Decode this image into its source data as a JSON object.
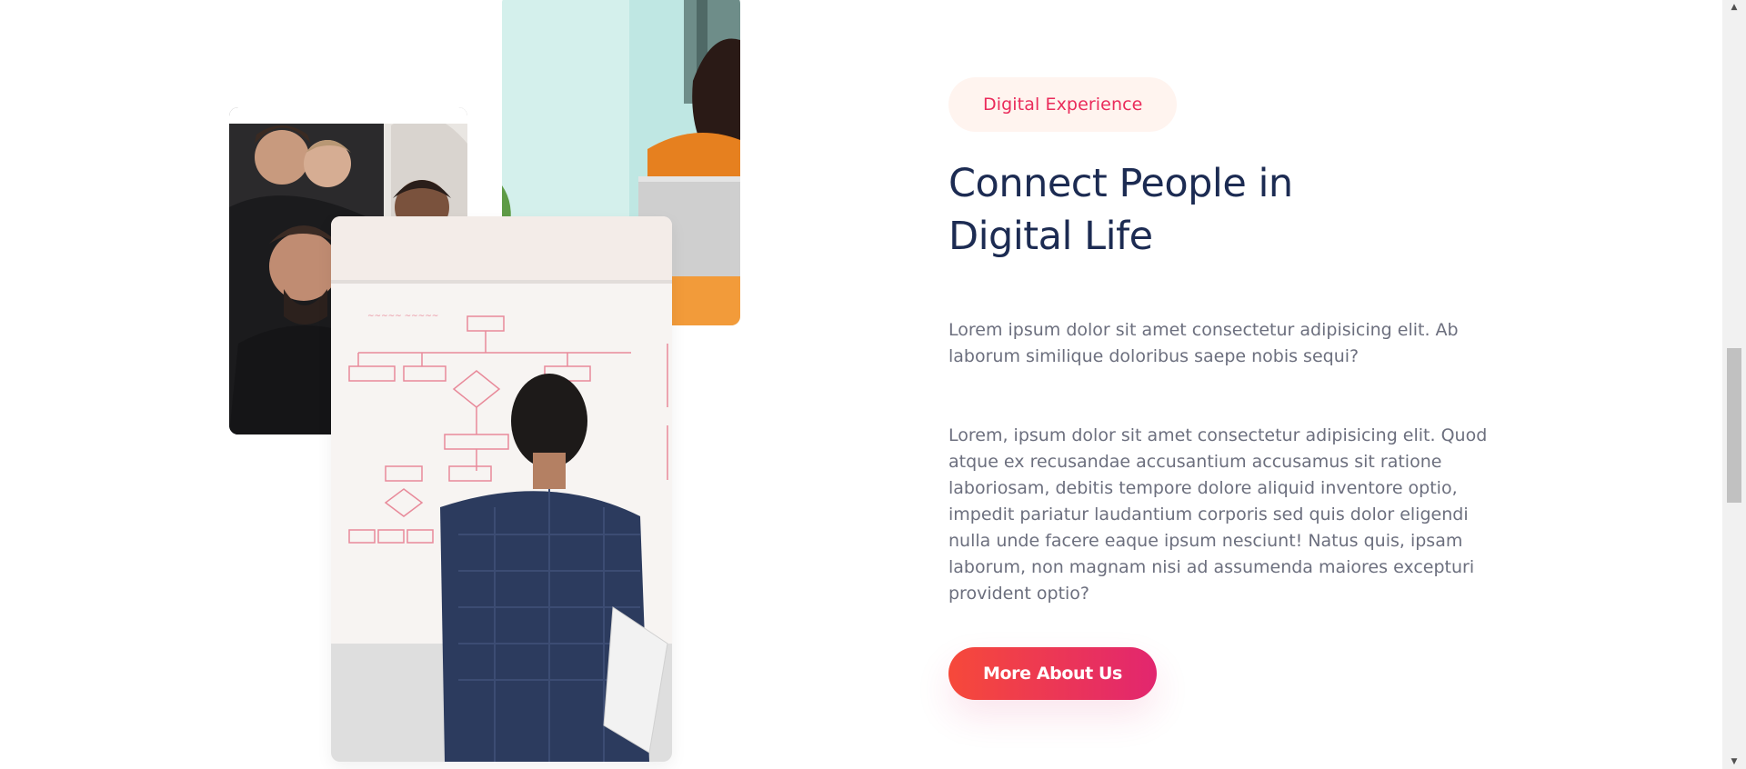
{
  "about": {
    "tag_label": "Digital Experience",
    "heading": "Connect People in Digital Life",
    "paragraph_1": "Lorem ipsum dolor sit amet consectetur adipisicing elit. Ab laborum similique doloribus saepe nobis sequi?",
    "paragraph_2": "Lorem, ipsum dolor sit amet consectetur adipisicing elit. Quod atque ex recusandae accusantium accusamus sit ratione laboriosam, debitis tempore dolore aliquid inventore optio, impedit pariatur laudantium corporis sed quis dolor eligendi nulla unde facere eaque ipsum nesciunt! Natus quis, ipsam laborum, non magnam nisi ad assumenda maiores excepturi provident optio?",
    "cta_label": "More About Us"
  },
  "images": {
    "team": "team-photo",
    "laptop": "woman-laptop-photo",
    "whiteboard": "whiteboard-photo"
  },
  "colors": {
    "accent": "#ea2b5b",
    "heading": "#1c2b52",
    "body_text": "#6c6f7e",
    "tag_bg": "#fff4ef",
    "cta_gradient_start": "#f6493a",
    "cta_gradient_end": "#e2266f"
  },
  "scrollbar": {
    "position_fraction": 0.57,
    "visible_fraction": 0.21
  }
}
